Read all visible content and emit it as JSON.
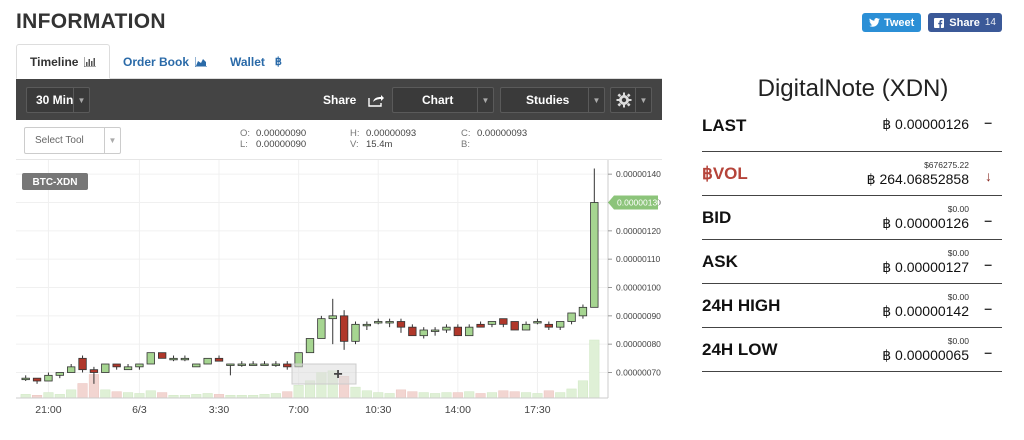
{
  "page": {
    "title": "INFORMATION"
  },
  "social": {
    "tweet_label": "Tweet",
    "share_label": "Share",
    "share_count": "14"
  },
  "tabs": [
    {
      "label": "Timeline",
      "icon": "bar-chart-icon"
    },
    {
      "label": "Order Book",
      "icon": "area-chart-icon"
    },
    {
      "label": "Wallet",
      "icon": "bitcoin-icon"
    }
  ],
  "toolbar": {
    "interval": "30 Min",
    "share": "Share",
    "chart": "Chart",
    "studies": "Studies",
    "settings_icon": "gear-icon"
  },
  "subbar": {
    "select_tool": "Select Tool",
    "ohlc": {
      "O": "0.00000090",
      "L": "0.00000090",
      "H": "0.00000093",
      "V": "15.4m",
      "C": "0.00000093",
      "B": ""
    }
  },
  "chart_data": {
    "type": "candlestick",
    "symbol": "BTC-XDN",
    "last_price_label": "0.00000130",
    "ylim": [
      6.1e-07,
      1.45e-06
    ],
    "y_ticks": [
      "0.00000140",
      "0.00000130",
      "0.00000120",
      "0.00000110",
      "0.00000100",
      "0.00000090",
      "0.00000080",
      "0.00000070"
    ],
    "x_ticks": [
      {
        "label": "21:00",
        "index": 2
      },
      {
        "label": "6/3",
        "index": 10
      },
      {
        "label": "3:30",
        "index": 17
      },
      {
        "label": "7:00",
        "index": 24
      },
      {
        "label": "10:30",
        "index": 31
      },
      {
        "label": "14:00",
        "index": 38
      },
      {
        "label": "17:30",
        "index": 45
      }
    ],
    "colors": {
      "up": "#a6d591",
      "down": "#b0372a",
      "vol_up": "#dff0d6",
      "vol_down": "#f2d5d1",
      "accent": "#8cc47a"
    },
    "candles": [
      [
        6.8e-07,
        6.9e-07,
        6.7e-07,
        6.8e-07,
        0.4
      ],
      [
        6.8e-07,
        6.8e-07,
        6.6e-07,
        6.7e-07,
        0.3
      ],
      [
        6.7e-07,
        7e-07,
        6.7e-07,
        6.9e-07,
        0.6
      ],
      [
        6.9e-07,
        7e-07,
        6.8e-07,
        7e-07,
        0.4
      ],
      [
        7e-07,
        7.3e-07,
        7e-07,
        7.2e-07,
        0.9
      ],
      [
        7.5e-07,
        7.6e-07,
        7e-07,
        7.1e-07,
        1.6
      ],
      [
        7.1e-07,
        7.2e-07,
        6.6e-07,
        7e-07,
        2.6
      ],
      [
        7e-07,
        7.3e-07,
        7e-07,
        7.3e-07,
        0.9
      ],
      [
        7.3e-07,
        7.3e-07,
        7.1e-07,
        7.2e-07,
        0.7
      ],
      [
        7.1e-07,
        7.3e-07,
        7.1e-07,
        7.2e-07,
        0.6
      ],
      [
        7.2e-07,
        7.3e-07,
        7.1e-07,
        7.3e-07,
        0.5
      ],
      [
        7.3e-07,
        7.7e-07,
        7.3e-07,
        7.7e-07,
        0.8
      ],
      [
        7.7e-07,
        7.7e-07,
        7.5e-07,
        7.5e-07,
        0.6
      ],
      [
        7.5e-07,
        7.6e-07,
        7.4e-07,
        7.5e-07,
        0.3
      ],
      [
        7.5e-07,
        7.6e-07,
        7.4e-07,
        7.5e-07,
        0.3
      ],
      [
        7.2e-07,
        7.3e-07,
        7.2e-07,
        7.3e-07,
        0.4
      ],
      [
        7.3e-07,
        7.5e-07,
        7.3e-07,
        7.5e-07,
        0.5
      ],
      [
        7.5e-07,
        7.6e-07,
        7.4e-07,
        7.4e-07,
        0.4
      ],
      [
        7.3e-07,
        7.3e-07,
        6.9e-07,
        7.3e-07,
        0.3
      ],
      [
        7.3e-07,
        7.4e-07,
        7.2e-07,
        7.3e-07,
        0.3
      ],
      [
        7.3e-07,
        7.4e-07,
        7.3e-07,
        7.3e-07,
        0.3
      ],
      [
        7.3e-07,
        7.4e-07,
        7.3e-07,
        7.3e-07,
        0.4
      ],
      [
        7.3e-07,
        7.4e-07,
        7.2e-07,
        7.3e-07,
        0.5
      ],
      [
        7.3e-07,
        7.4e-07,
        7.1e-07,
        7.2e-07,
        0.7
      ],
      [
        7.2e-07,
        7.7e-07,
        7.2e-07,
        7.7e-07,
        1.4
      ],
      [
        7.7e-07,
        8.2e-07,
        7.7e-07,
        8.2e-07,
        1.9
      ],
      [
        8.2e-07,
        9e-07,
        8.2e-07,
        8.9e-07,
        2.8
      ],
      [
        8.9e-07,
        9.6e-07,
        8e-07,
        9e-07,
        3.0
      ],
      [
        9e-07,
        9.2e-07,
        7.8e-07,
        8.1e-07,
        2.4
      ],
      [
        8.1e-07,
        8.8e-07,
        8e-07,
        8.7e-07,
        1.2
      ],
      [
        8.7e-07,
        8.8e-07,
        8.5e-07,
        8.7e-07,
        0.8
      ],
      [
        8.8e-07,
        8.9e-07,
        8.7e-07,
        8.8e-07,
        0.6
      ],
      [
        8.8e-07,
        8.9e-07,
        8.6e-07,
        8.8e-07,
        0.5
      ],
      [
        8.8e-07,
        8.9e-07,
        8.4e-07,
        8.6e-07,
        0.9
      ],
      [
        8.6e-07,
        8.7e-07,
        8.3e-07,
        8.3e-07,
        0.7
      ],
      [
        8.3e-07,
        8.6e-07,
        8.2e-07,
        8.5e-07,
        0.6
      ],
      [
        8.5e-07,
        8.6e-07,
        8.3e-07,
        8.5e-07,
        0.5
      ],
      [
        8.5e-07,
        8.7e-07,
        8.4e-07,
        8.6e-07,
        0.6
      ],
      [
        8.6e-07,
        8.7e-07,
        8.3e-07,
        8.3e-07,
        0.6
      ],
      [
        8.3e-07,
        8.7e-07,
        8.3e-07,
        8.6e-07,
        0.7
      ],
      [
        8.7e-07,
        8.8e-07,
        8.6e-07,
        8.6e-07,
        0.5
      ],
      [
        8.7e-07,
        8.8e-07,
        8.6e-07,
        8.8e-07,
        0.6
      ],
      [
        8.9e-07,
        8.9e-07,
        8.6e-07,
        8.7e-07,
        0.8
      ],
      [
        8.8e-07,
        8.8e-07,
        8.5e-07,
        8.5e-07,
        0.7
      ],
      [
        8.5e-07,
        8.8e-07,
        8.5e-07,
        8.7e-07,
        0.6
      ],
      [
        8.8e-07,
        8.9e-07,
        8.7e-07,
        8.8e-07,
        0.5
      ],
      [
        8.7e-07,
        8.8e-07,
        8.5e-07,
        8.6e-07,
        0.8
      ],
      [
        8.6e-07,
        8.8e-07,
        8.5e-07,
        8.8e-07,
        0.6
      ],
      [
        8.8e-07,
        9.1e-07,
        8.7e-07,
        9.1e-07,
        1.0
      ],
      [
        9e-07,
        9.4e-07,
        8.9e-07,
        9.3e-07,
        1.9
      ],
      [
        9.3e-07,
        1.42e-06,
        9.3e-07,
        1.3e-06,
        6.4
      ]
    ]
  },
  "market": {
    "title": "DigitalNote (XDN)",
    "rows": [
      {
        "label": "LAST",
        "usd": "",
        "value": "฿ 0.00000126",
        "trend": "–",
        "trend_icon": "dash-icon"
      },
      {
        "label": "฿VOL",
        "usd": "$676275.22",
        "value": "฿ 264.06852858",
        "trend": "↓",
        "trend_icon": "arrow-down-icon",
        "label_color": "#b5443a",
        "trend_color": "#8a2a22"
      },
      {
        "label": "BID",
        "usd": "$0.00",
        "value": "฿ 0.00000126",
        "trend": "–",
        "trend_icon": "dash-icon"
      },
      {
        "label": "ASK",
        "usd": "$0.00",
        "value": "฿ 0.00000127",
        "trend": "–",
        "trend_icon": "dash-icon"
      },
      {
        "label": "24H HIGH",
        "usd": "$0.00",
        "value": "฿ 0.00000142",
        "trend": "–",
        "trend_icon": "dash-icon"
      },
      {
        "label": "24H LOW",
        "usd": "$0.00",
        "value": "฿ 0.00000065",
        "trend": "–",
        "trend_icon": "dash-icon"
      }
    ]
  }
}
